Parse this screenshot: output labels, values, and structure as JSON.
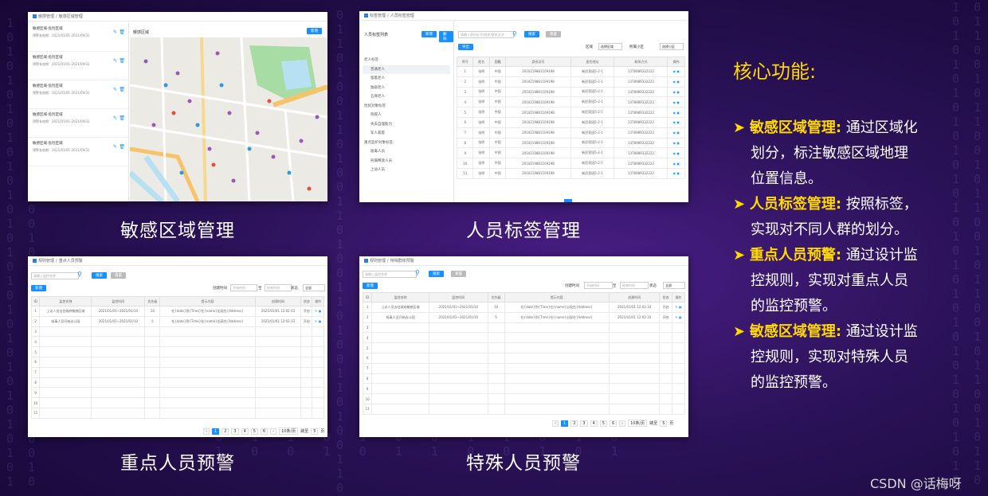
{
  "panels": {
    "p1": {
      "breadcrumb": [
        "敏感管理",
        "敏感区域管理"
      ],
      "caption": "敏感区域管理",
      "map_title": "敏感区域",
      "add_button": "新增",
      "list": [
        {
          "name": "敏感区域-危险区域",
          "date": "预警有效期：2021/01/01-2021/09/31"
        },
        {
          "name": "敏感区域-危险区域",
          "date": "预警有效期：2021/01/01-2021/09/31"
        },
        {
          "name": "敏感区域-危险区域",
          "date": "预警有效期：2021/01/01-2021/09/31"
        },
        {
          "name": "敏感区域-危险区域",
          "date": "预警有效期：2021/01/01-2021/09/31"
        },
        {
          "name": "敏感区域-危险区域",
          "date": "预警有效期：2021/01/01-2021/09/31"
        }
      ]
    },
    "p2": {
      "breadcrumb": [
        "标签管理",
        "人员标签管理"
      ],
      "caption": "人员标签管理",
      "tree_title": "人员标签列表",
      "btn_add": "新增",
      "btn_del": "删除",
      "search_placeholder": "请输入身份证号/姓名/联系方式",
      "btn_search": "搜索",
      "btn_reset": "重置",
      "btn_export": "导出",
      "filter1_label": "区域",
      "filter1_value": "选择区域",
      "filter2_label": "所属小区",
      "filter2_value": "选择小区",
      "tree": [
        "老人标签",
        "普通老人",
        "留着老人",
        "独居老人",
        "五保老人",
        "优抚对象标签",
        "残疾人",
        "失去自理能力",
        "军人家庭",
        "重点监护对象标签",
        "吸毒人员",
        "刑满释放人员",
        "上访人员"
      ],
      "columns": [
        "序号",
        "姓名",
        "国籍",
        "身份证号",
        "居住地址",
        "联系方式",
        "操作"
      ],
      "row": {
        "name": "张明",
        "nation": "中国",
        "id": "2010219881109198",
        "addr": "新民家园5-2-1",
        "phone": "1378989332222"
      },
      "row_count": 11
    },
    "p3": {
      "breadcrumb": [
        "规则管理",
        "重点人员预警"
      ],
      "caption": "重点人员预警",
      "search_placeholder": "请输入监控名称",
      "btn_search": "搜索",
      "btn_reset": "重置",
      "btn_add": "新增",
      "time_label": "创建时间",
      "start_placeholder": "开始时间",
      "to": "至",
      "end_placeholder": "结束时间",
      "status_label": "状态",
      "status_value": "全部",
      "columns": [
        "ID",
        "监控名称",
        "监控时间",
        "优先级",
        "提示内容",
        "创建时间",
        "状态",
        "操作"
      ],
      "rows": [
        [
          "1",
          "上访人员去往政府敏感区域",
          "2021/01/01~2021/01/10",
          "10",
          "在{date}到{Time}在{name}出现在{Address}",
          "2021/01/01 12:02:33",
          "开启"
        ],
        [
          "2",
          "吸毒人员开始去公园",
          "2021/01/01~2021/01/10",
          "5",
          "在{date}到{Time}在{name}出现在{Address}",
          "2021/01/01 12:02:33",
          "开启"
        ]
      ],
      "row_numbers": [
        "3",
        "4",
        "5",
        "6",
        "7",
        "8",
        "9",
        "10",
        "11"
      ],
      "pages": [
        "1",
        "2",
        "3",
        "4",
        "5",
        "6"
      ],
      "per_page": "10条/页",
      "jump_label": "跳至",
      "jump_value": "5",
      "page_unit": "页"
    },
    "p4": {
      "breadcrumb": [
        "规则管理",
        "特殊群体预警"
      ],
      "caption": "特殊人员预警",
      "search_placeholder": "请输入监控名称",
      "btn_search": "搜索",
      "btn_reset": "重置",
      "btn_add": "新增",
      "time_label": "创建时间",
      "start_placeholder": "开始时间",
      "to": "至",
      "end_placeholder": "结束时间",
      "status_label": "状态",
      "status_value": "全部",
      "columns": [
        "ID",
        "监控名称",
        "监控时间",
        "优先级",
        "提示内容",
        "创建时间",
        "状态",
        "操作"
      ],
      "rows": [
        [
          "1",
          "上访人员去往政府敏感区域",
          "2021/01/01~2021/01/10",
          "10",
          "在{date}到{Time}在{name}出现在{Address}",
          "2021/01/01 12:02:33",
          "开启"
        ],
        [
          "2",
          "吸毒人员开始去公园",
          "2021/01/01~2021/01/10",
          "5",
          "在{date}到{Time}在{name}出现在{Address}",
          "2021/01/01 12:02:33",
          "开启"
        ]
      ],
      "row_numbers": [
        "3",
        "4",
        "5",
        "6",
        "7",
        "8",
        "9",
        "10",
        "11"
      ],
      "pages": [
        "1",
        "2",
        "3",
        "4",
        "5",
        "6"
      ],
      "per_page": "10条/页",
      "jump_label": "跳至",
      "jump_value": "5",
      "page_unit": "页"
    }
  },
  "side": {
    "title": "核心功能:",
    "features": [
      {
        "head": "敏感区域管理:",
        "lines": [
          " 通过区域化",
          "划分，标注敏感区域地理",
          "位置信息。"
        ]
      },
      {
        "head": "人员标签管理:",
        "lines": [
          " 按照标签，",
          "实现对不同人群的划分。"
        ]
      },
      {
        "head": "重点人员预警:",
        "lines": [
          " 通过设计监",
          "控规则，实现对重点人员",
          "的监控预警。"
        ]
      },
      {
        "head": "敏感区域管理:",
        "lines": [
          " 通过设计监",
          "控规则，实现对特殊人员",
          "的监控预警。"
        ]
      }
    ]
  },
  "watermark": "CSDN @话梅呀",
  "colors": {
    "accent": "#1890ff",
    "highlight": "#ffd900"
  }
}
